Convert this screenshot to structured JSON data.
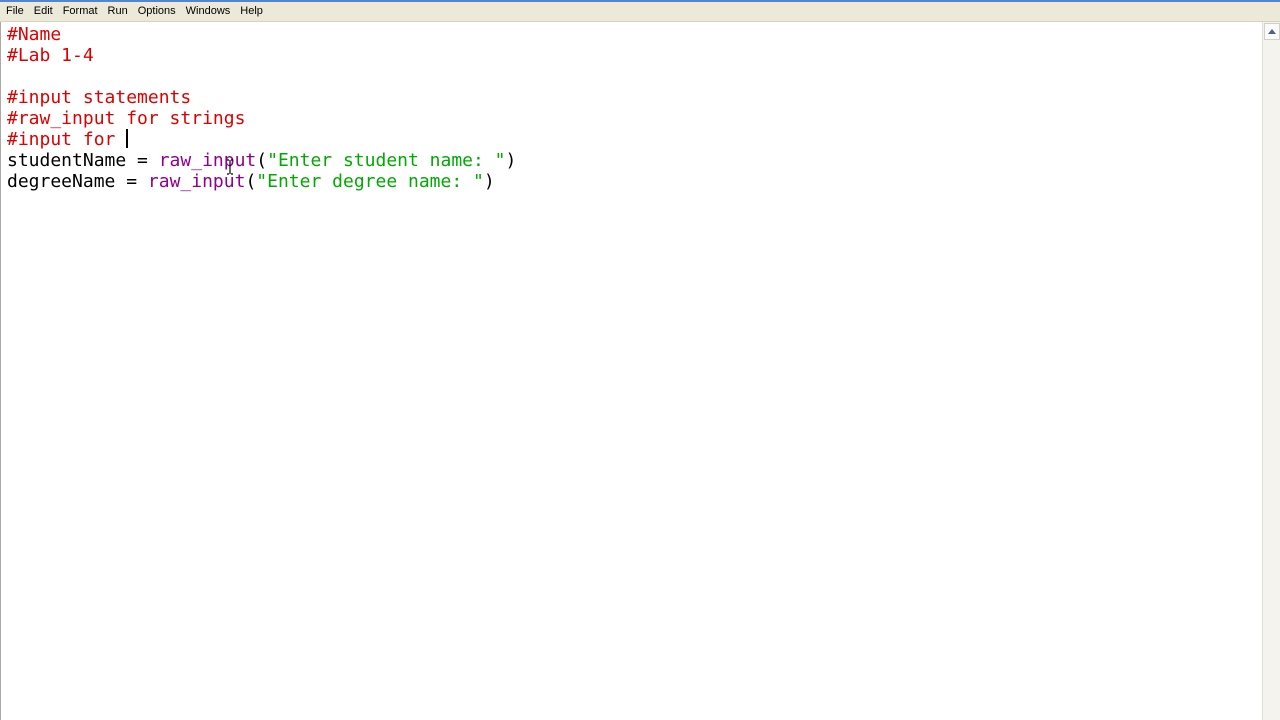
{
  "menubar": {
    "items": [
      "File",
      "Edit",
      "Format",
      "Run",
      "Options",
      "Windows",
      "Help"
    ]
  },
  "editor": {
    "lines": [
      [
        {
          "t": "#Name",
          "c": "comment"
        }
      ],
      [
        {
          "t": "#Lab 1-4",
          "c": "comment"
        }
      ],
      [],
      [
        {
          "t": "#input statements",
          "c": "comment"
        }
      ],
      [
        {
          "t": "#raw_input for strings",
          "c": "comment"
        }
      ],
      [
        {
          "t": "#input for ",
          "c": "comment"
        },
        {
          "caret": true
        }
      ],
      [
        {
          "t": "studentName = ",
          "c": "plain"
        },
        {
          "t": "raw_input",
          "c": "builtin"
        },
        {
          "t": "(",
          "c": "plain"
        },
        {
          "t": "\"Enter student name: \"",
          "c": "string"
        },
        {
          "t": ")",
          "c": "plain"
        }
      ],
      [
        {
          "t": "degreeName = ",
          "c": "plain"
        },
        {
          "t": "raw_input",
          "c": "builtin"
        },
        {
          "t": "(",
          "c": "plain"
        },
        {
          "t": "\"Enter degree name: \"",
          "c": "string"
        },
        {
          "t": ")",
          "c": "plain"
        }
      ]
    ]
  },
  "colors": {
    "comment": "#dd0000",
    "builtin": "#900090",
    "string": "#00aa00",
    "menubar_bg": "#ece9d8"
  },
  "icons": {
    "scroll_up": "triangle-up-icon",
    "cursor": "ibeam-cursor-icon"
  }
}
